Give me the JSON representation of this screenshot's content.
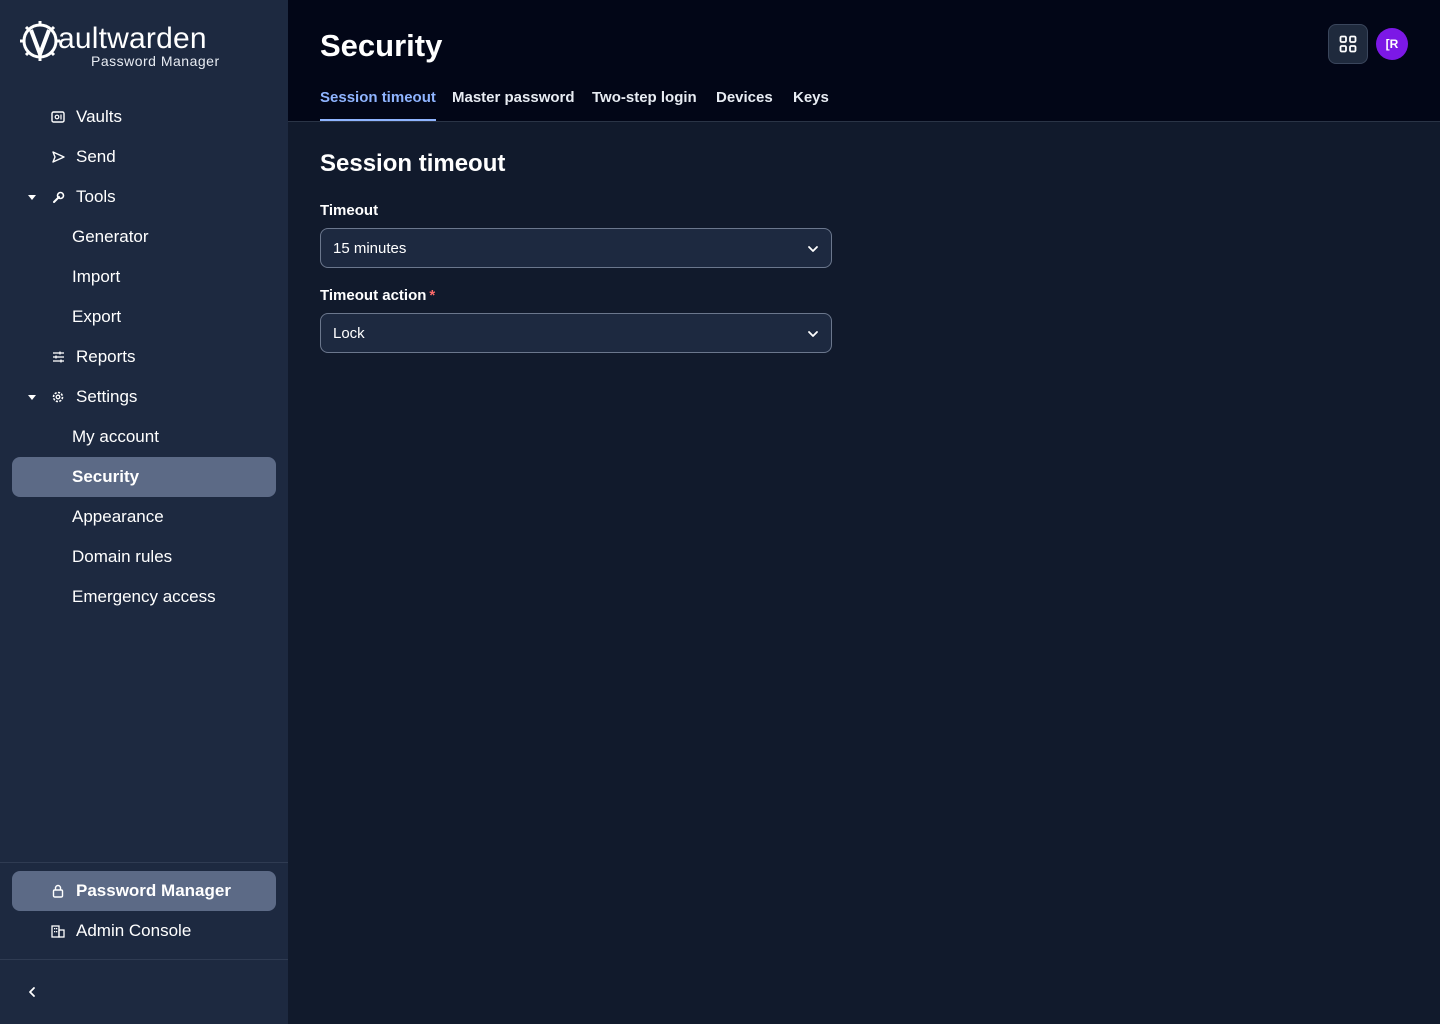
{
  "logo": {
    "brand_bold": "V",
    "brand_rest": "aultwarden",
    "subtitle": "Password Manager"
  },
  "sidebar": {
    "items": [
      {
        "label": "Vaults",
        "icon": "vault-icon"
      },
      {
        "label": "Send",
        "icon": "send-icon"
      },
      {
        "label": "Tools",
        "icon": "wrench-icon",
        "expanded": true
      },
      {
        "label": "Generator"
      },
      {
        "label": "Import"
      },
      {
        "label": "Export"
      },
      {
        "label": "Reports",
        "icon": "sliders-icon"
      },
      {
        "label": "Settings",
        "icon": "gear-icon",
        "expanded": true
      },
      {
        "label": "My account"
      },
      {
        "label": "Security",
        "active": true
      },
      {
        "label": "Appearance"
      },
      {
        "label": "Domain rules"
      },
      {
        "label": "Emergency access"
      }
    ],
    "footer": [
      {
        "label": "Password Manager",
        "icon": "lock-icon",
        "active": true
      },
      {
        "label": "Admin Console",
        "icon": "building-icon"
      }
    ]
  },
  "header": {
    "title": "Security",
    "avatar_initials": "[R",
    "tabs": [
      {
        "label": "Session timeout",
        "active": true
      },
      {
        "label": "Master password"
      },
      {
        "label": "Two-step login"
      },
      {
        "label": "Devices"
      },
      {
        "label": "Keys"
      }
    ]
  },
  "main": {
    "section_title": "Session timeout",
    "timeout": {
      "label": "Timeout",
      "value": "15 minutes"
    },
    "timeout_action": {
      "label": "Timeout action",
      "required_mark": "*",
      "value": "Lock"
    }
  },
  "colors": {
    "accent": "#8fb4ff",
    "avatar": "#7c18e6",
    "active_nav": "#5c6a86"
  }
}
